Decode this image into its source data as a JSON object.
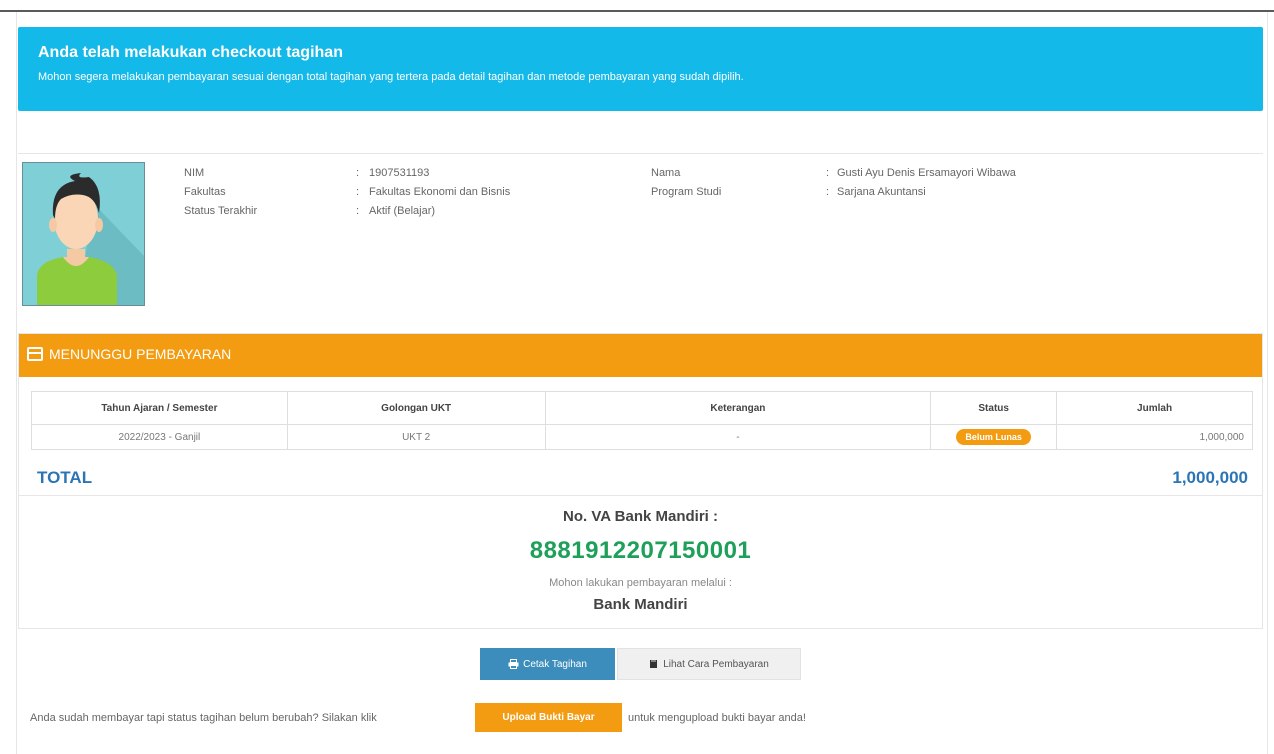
{
  "alert": {
    "title": "Anda telah melakukan checkout tagihan",
    "message": "Mohon segera melakukan pembayaran sesuai dengan total tagihan yang tertera pada detail tagihan dan metode pembayaran yang sudah dipilih."
  },
  "profile": {
    "sep": ":",
    "nim_label": "NIM",
    "nim_value": "1907531193",
    "faculty_label": "Fakultas",
    "faculty_value": "Fakultas Ekonomi dan Bisnis",
    "status_label": "Status Terakhir",
    "status_value": "Aktif (Belajar)",
    "name_label": "Nama",
    "name_value": "Gusti Ayu Denis Ersamayori Wibawa",
    "program_label": "Program Studi",
    "program_value": "Sarjana Akuntansi"
  },
  "payment": {
    "header": "MENUNGGU PEMBAYARAN",
    "columns": [
      "Tahun Ajaran / Semester",
      "Golongan UKT",
      "Keterangan",
      "Status",
      "Jumlah"
    ],
    "row": {
      "semester": "2022/2023 - Ganjil",
      "ukt": "UKT 2",
      "note": "-",
      "status": "Belum Lunas",
      "amount": "1,000,000"
    },
    "total_label": "TOTAL",
    "total_value": "1,000,000",
    "va_title": "No. VA Bank Mandiri :",
    "va_number": "8881912207150001",
    "va_note": "Mohon lakukan pembayaran melalui :",
    "va_bank": "Bank Mandiri"
  },
  "actions": {
    "print_label": "Cetak Tagihan",
    "guide_label": "Lihat Cara Pembayaran",
    "upload_prefix": "Anda sudah membayar tapi status tagihan belum berubah? Silakan klik",
    "upload_label": "Upload Bukti Bayar",
    "upload_suffix": "untuk mengupload bukti bayar anda!"
  },
  "colors": {
    "alert_bg": "#12b9e9",
    "panel_header": "#f39c12",
    "total_text": "#2b74b5",
    "va_number": "#1ea05a",
    "print_button": "#3c8dbc"
  },
  "icons": [
    "credit-card-icon",
    "print-icon",
    "book-icon",
    "avatar-icon"
  ]
}
